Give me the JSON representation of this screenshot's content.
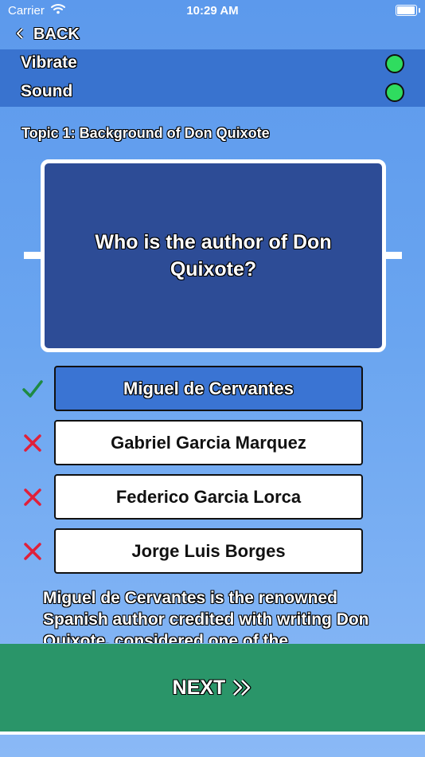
{
  "status_bar": {
    "carrier": "Carrier",
    "time": "10:29 AM"
  },
  "nav": {
    "back_label": "BACK"
  },
  "settings": [
    {
      "label": "Vibrate",
      "enabled": true
    },
    {
      "label": "Sound",
      "enabled": true
    }
  ],
  "topic": "Topic 1: Background of Don Quixote",
  "question": "Who is the author of Don Quixote?",
  "answers": [
    {
      "label": "Miguel de Cervantes",
      "status": "correct"
    },
    {
      "label": "Gabriel Garcia Marquez",
      "status": "wrong"
    },
    {
      "label": "Federico Garcia Lorca",
      "status": "wrong"
    },
    {
      "label": "Jorge Luis Borges",
      "status": "wrong"
    }
  ],
  "explanation": "Miguel de Cervantes is the renowned Spanish author credited with writing Don Quixote, considered one of the",
  "next": {
    "label": "NEXT"
  },
  "colors": {
    "background": "#5c99ec",
    "settings_bar": "#3973cf",
    "question_card": "#2d4c96",
    "correct_answer": "#3a74d3",
    "next_panel": "#2a9569",
    "toggle_on": "#2fdc5f",
    "check_mark": "#1e8a43",
    "cross_mark": "#e0203a"
  }
}
